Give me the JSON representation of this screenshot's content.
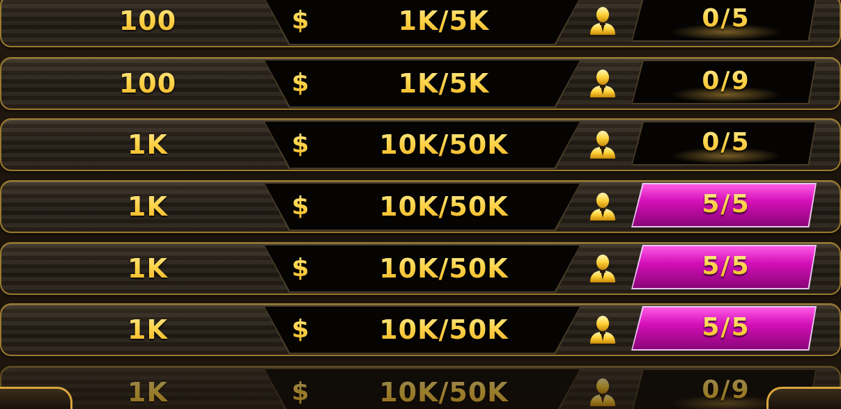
{
  "rooms": [
    {
      "min_bet": "100",
      "currency_symbol": "$",
      "bet_range": "1K/5K",
      "seats": "0/5",
      "full": false,
      "faded": false
    },
    {
      "min_bet": "100",
      "currency_symbol": "$",
      "bet_range": "1K/5K",
      "seats": "0/9",
      "full": false,
      "faded": false
    },
    {
      "min_bet": "1K",
      "currency_symbol": "$",
      "bet_range": "10K/50K",
      "seats": "0/5",
      "full": false,
      "faded": false
    },
    {
      "min_bet": "1K",
      "currency_symbol": "$",
      "bet_range": "10K/50K",
      "seats": "5/5",
      "full": true,
      "faded": false
    },
    {
      "min_bet": "1K",
      "currency_symbol": "$",
      "bet_range": "10K/50K",
      "seats": "5/5",
      "full": true,
      "faded": false
    },
    {
      "min_bet": "1K",
      "currency_symbol": "$",
      "bet_range": "10K/50K",
      "seats": "5/5",
      "full": true,
      "faded": false
    },
    {
      "min_bet": "1K",
      "currency_symbol": "$",
      "bet_range": "10K/50K",
      "seats": "0/9",
      "full": false,
      "faded": true
    }
  ],
  "icons": {
    "player": "player-icon",
    "currency": "dollar-icon"
  },
  "colors": {
    "gold_text": "#ffd54d",
    "row_border": "#9a7a2e",
    "full_seat": "#d410b8",
    "panel": "#050403"
  }
}
